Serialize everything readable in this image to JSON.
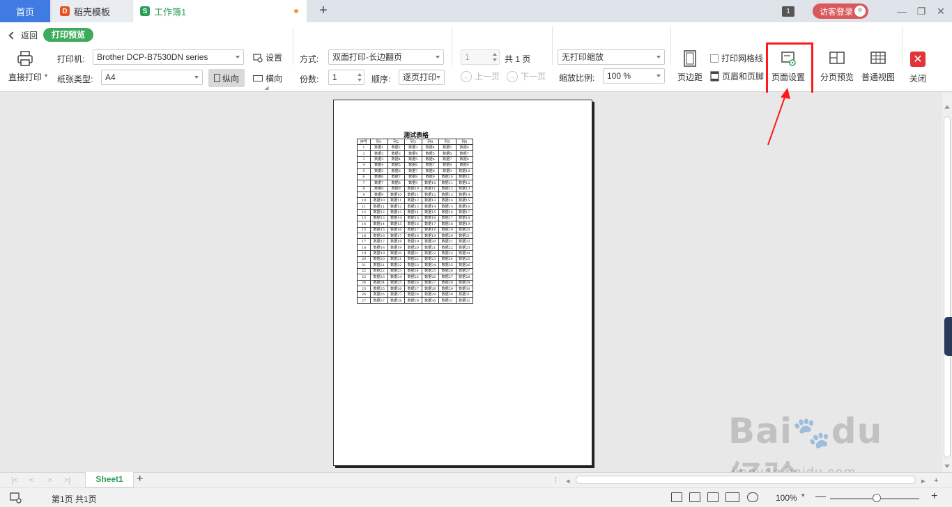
{
  "tabs": {
    "home": "首页",
    "templates": "稻壳模板",
    "workbook": "工作簿1",
    "badge": "1",
    "login": "访客登录"
  },
  "ribbon": {
    "back": "返回",
    "mode": "打印预览",
    "direct_print": "直接打印",
    "printer_label": "打印机:",
    "printer_value": "Brother DCP-B7530DN series",
    "settings": "设置",
    "paper_label": "纸张类型:",
    "paper_value": "A4",
    "portrait": "纵向",
    "landscape": "横向",
    "method_label": "方式:",
    "method_value": "双面打印-长边翻页",
    "copies_label": "份数:",
    "copies_value": "1",
    "order_label": "顺序:",
    "order_value": "逐页打印",
    "page_value": "1",
    "total_pages": "共 1 页",
    "prev_page": "上一页",
    "next_page": "下一页",
    "scale_value": "无打印缩放",
    "zoom_label": "缩放比例:",
    "zoom_value": "100 %",
    "margins": "页边距",
    "print_gridlines": "打印网格线",
    "header_footer": "页眉和页脚",
    "page_setup": "页面设置",
    "page_break_preview": "分页预览",
    "normal_view": "普通视图",
    "close": "关闭"
  },
  "sheet": {
    "title": "测试表格",
    "headers": [
      "序号",
      "列1",
      "列2",
      "列3",
      "列4",
      "列5",
      "列6"
    ],
    "row_count": 27,
    "cell_prefix": "数据"
  },
  "sheetbar": {
    "sheet_name": "Sheet1"
  },
  "status": {
    "page_info": "第1页 共1页",
    "zoom": "100%"
  },
  "colors": {
    "accent_green": "#2e9d5a",
    "home_tab": "#3f7be3",
    "highlight": "#ff1a1a",
    "close": "#e0363a"
  }
}
